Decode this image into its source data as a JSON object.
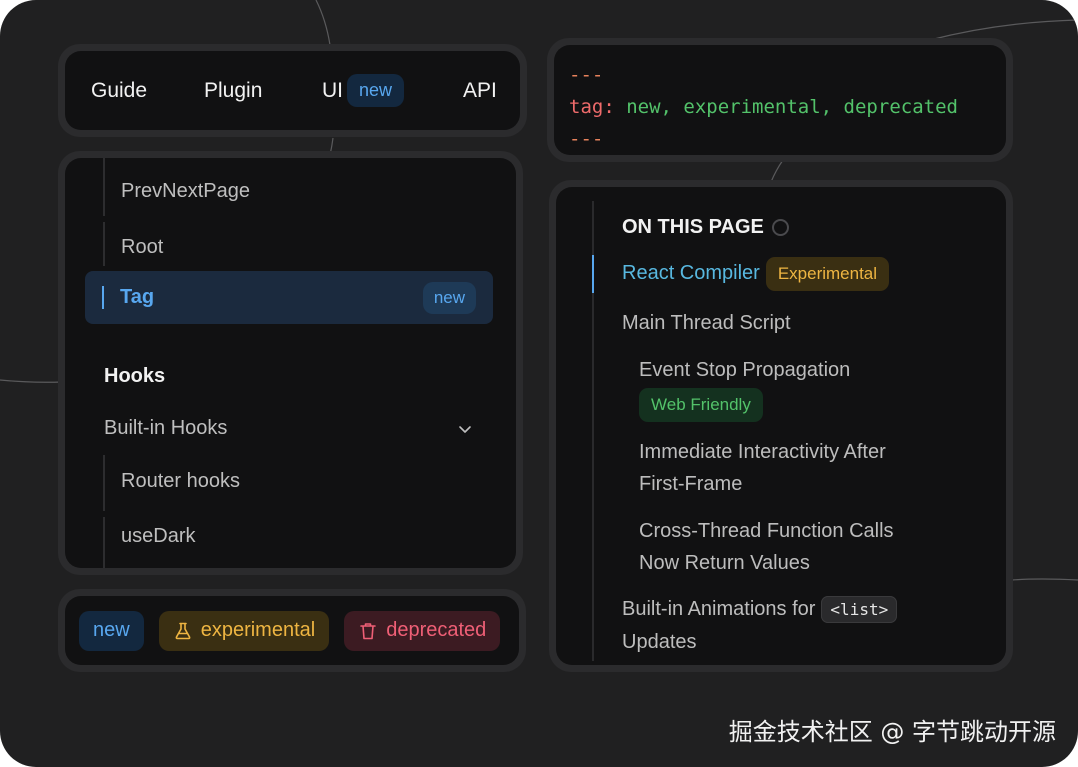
{
  "nav": {
    "items": [
      "Guide",
      "Plugin",
      "UI",
      "API"
    ],
    "ui_badge": "new"
  },
  "sidebar": {
    "items_top": [
      "PrevNextPage",
      "Root"
    ],
    "active": {
      "label": "Tag",
      "badge": "new"
    },
    "section_heading": "Hooks",
    "group": "Built-in Hooks",
    "group_items": [
      "Router hooks",
      "useDark"
    ]
  },
  "badges": {
    "new": "new",
    "experimental": "experimental",
    "deprecated": "deprecated"
  },
  "code": {
    "delimiter": "---",
    "key": "tag:",
    "value": "new, experimental, deprecated"
  },
  "toc": {
    "title": "ON THIS PAGE",
    "items": [
      {
        "label": "React Compiler",
        "badge": "Experimental"
      },
      {
        "label": "Main Thread Script"
      },
      {
        "label": "Event Stop Propagation",
        "badge": "Web Friendly"
      },
      {
        "label": "Immediate Interactivity After",
        "label2": "First-Frame"
      },
      {
        "label": "Cross-Thread Function Calls",
        "label2": "Now Return Values"
      },
      {
        "label": "Built-in Animations for",
        "code": "<list>",
        "label2": "Updates"
      }
    ]
  },
  "watermark": "掘金技术社区 @ 字节跳动开源",
  "colors": {
    "accent_blue": "#58a7ef",
    "experimental_amber": "#eeb542",
    "deprecated_red": "#ef5f76",
    "web_green": "#53c26a"
  }
}
